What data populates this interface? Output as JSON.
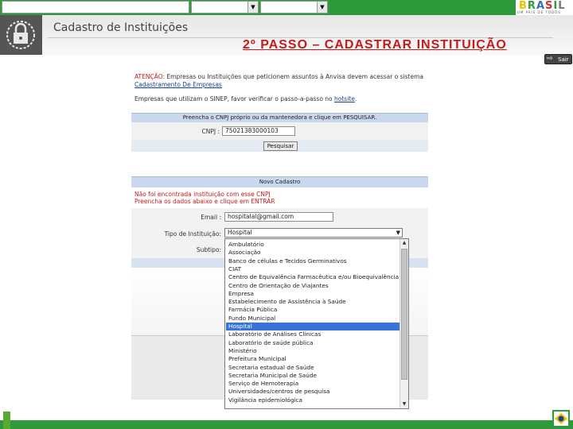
{
  "header": {
    "title": "Cadastro de Instituições",
    "step_title": "2º PASSO – CADASTRAR INSTITUIÇÃO",
    "exit_label": "Sair"
  },
  "brand": {
    "word_letters": [
      "B",
      "R",
      "A",
      "S",
      "I",
      "L"
    ],
    "slogan": "UM PAÍS DE TODOS",
    "colors": {
      "green": "#2e9a3c",
      "red": "#c71a1a",
      "blue_link": "#1b3f93",
      "selected": "#3874d8"
    }
  },
  "notice": {
    "attention_prefix": "ATENÇÃO:",
    "attention_text": " Empresas ou Instituições que peticionem assuntos à Anvisa devem acessar o sistema",
    "link_text": "Cadastramento De Empresas",
    "sinep_text": "Empresas que utilizam o SINEP, favor verificar o passo-a-passo no ",
    "hotsite_link": "hotsite",
    "sinep_end": "."
  },
  "search": {
    "heading": "Preencha o CNPJ próprio ou da mantenedora e clique em PESQUISAR.",
    "cnpj_label": "CNPJ :",
    "cnpj_value": "75021383000103",
    "search_button": "Pesquisar"
  },
  "new_cadastro": {
    "heading": "Novo Cadastro",
    "msg_line1": "Não foi encontrada instituição com esse CNPJ",
    "msg_line2": "Preencha os dados abaixo e clique em ENTRAR",
    "email_label": "Email :",
    "email_value": "hospitalal@gmail.com",
    "type_label": "Tipo de Instituição:",
    "type_value": "Hospital",
    "subtype_label": "Subtipo:"
  },
  "dropdown": {
    "selected_index": 10,
    "options": [
      "Ambulatório",
      "Associação",
      "Banco de células e Tecidos Germinativos",
      "CIAT",
      "Centro de Equivalência Farmacêutica e/ou Bioequivalência",
      "Centro de Orientação de Viajantes",
      "Empresa",
      "Estabelecimento de Assistência à Saúde",
      "Farmácia Pública",
      "Fundo Municipal",
      "Hospital",
      "Laboratório de Análises Clínicas",
      "Laboratório de saúde pública",
      "Ministério",
      "Prefeitura Municipal",
      "Secretaria estadual de Saúde",
      "Secretaria Municipal de Saúde",
      "Serviço de Hemoterapia",
      "Universidades/centros de pesquisa",
      "Vigilância epidemiológica"
    ]
  }
}
